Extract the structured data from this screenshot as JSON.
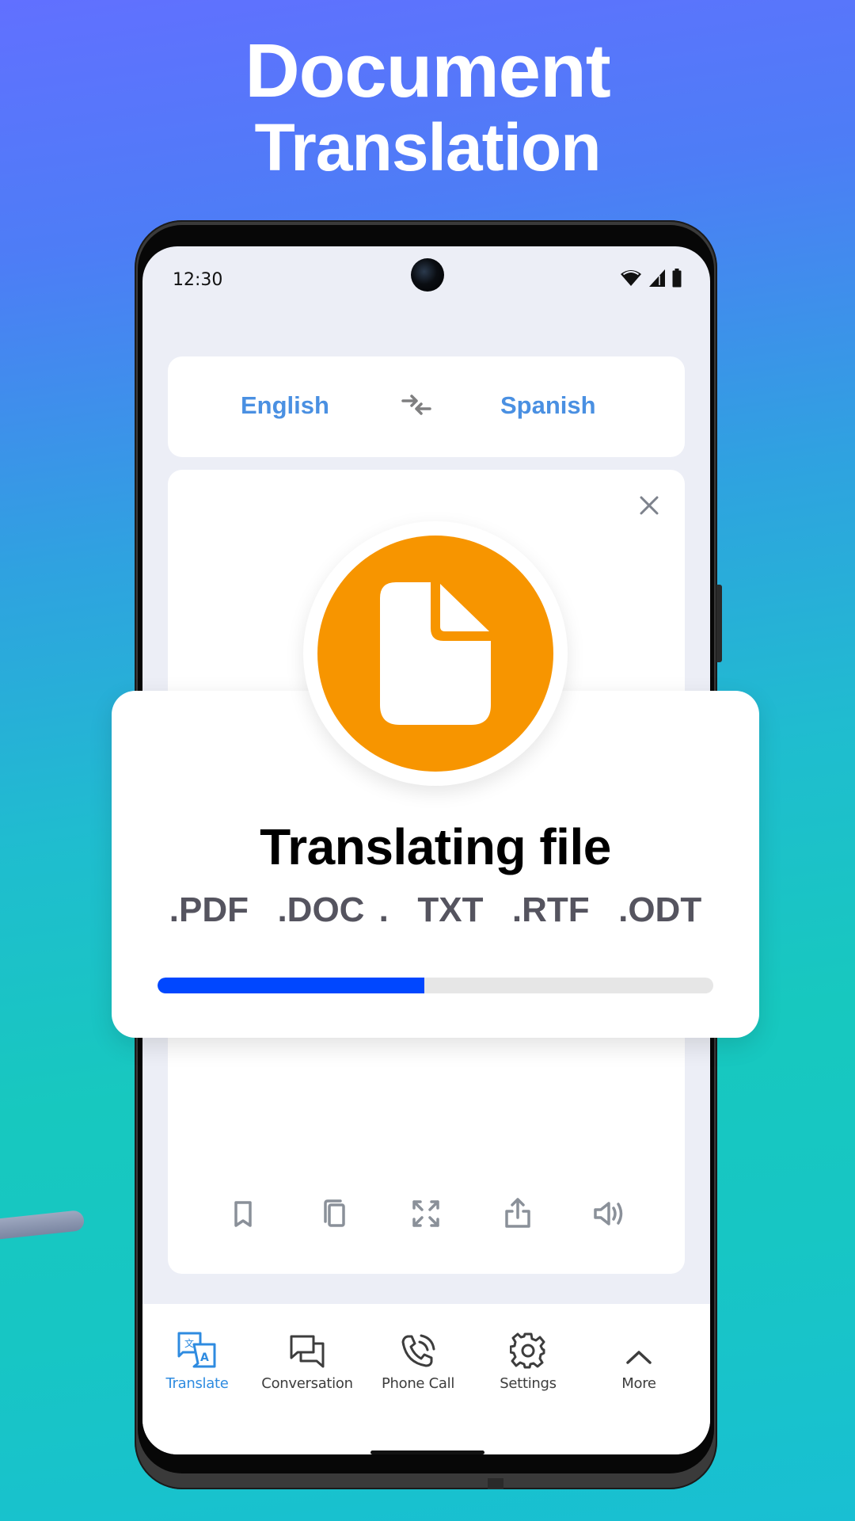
{
  "headline": {
    "line1": "Document",
    "line2": "Translation"
  },
  "status_bar": {
    "time": "12:30",
    "icons": [
      "wifi-icon",
      "cellular-signal-icon",
      "battery-icon"
    ]
  },
  "language_selector": {
    "source": "English",
    "target": "Spanish",
    "swap_icon": "swap-arrows-icon"
  },
  "content_card": {
    "close_icon": "close-icon",
    "actions": [
      {
        "name": "bookmark",
        "icon": "bookmark-icon"
      },
      {
        "name": "copy",
        "icon": "copy-icon"
      },
      {
        "name": "fullscreen",
        "icon": "expand-icon"
      },
      {
        "name": "share",
        "icon": "share-icon"
      },
      {
        "name": "speak",
        "icon": "speaker-icon"
      }
    ]
  },
  "overlay": {
    "icon": "document-icon",
    "title": "Translating file",
    "formats": ".PDF  .DOC .  TXT  .RTF  .ODT",
    "progress_percent": 48
  },
  "bottom_nav": {
    "items": [
      {
        "label": "Translate",
        "icon": "translate-icon",
        "active": true
      },
      {
        "label": "Conversation",
        "icon": "chat-bubbles-icon",
        "active": false
      },
      {
        "label": "Phone Call",
        "icon": "phone-call-icon",
        "active": false
      },
      {
        "label": "Settings",
        "icon": "gear-icon",
        "active": false
      },
      {
        "label": "More",
        "icon": "chevron-up-icon",
        "active": false
      }
    ]
  },
  "colors": {
    "accent_blue": "#4A90E2",
    "nav_active": "#2E8BE0",
    "badge_orange": "#F79500",
    "progress_fill": "#0047FF",
    "progress_track": "#E6E6E6",
    "format_text": "#55545F",
    "icon_gray": "#8A9099"
  }
}
